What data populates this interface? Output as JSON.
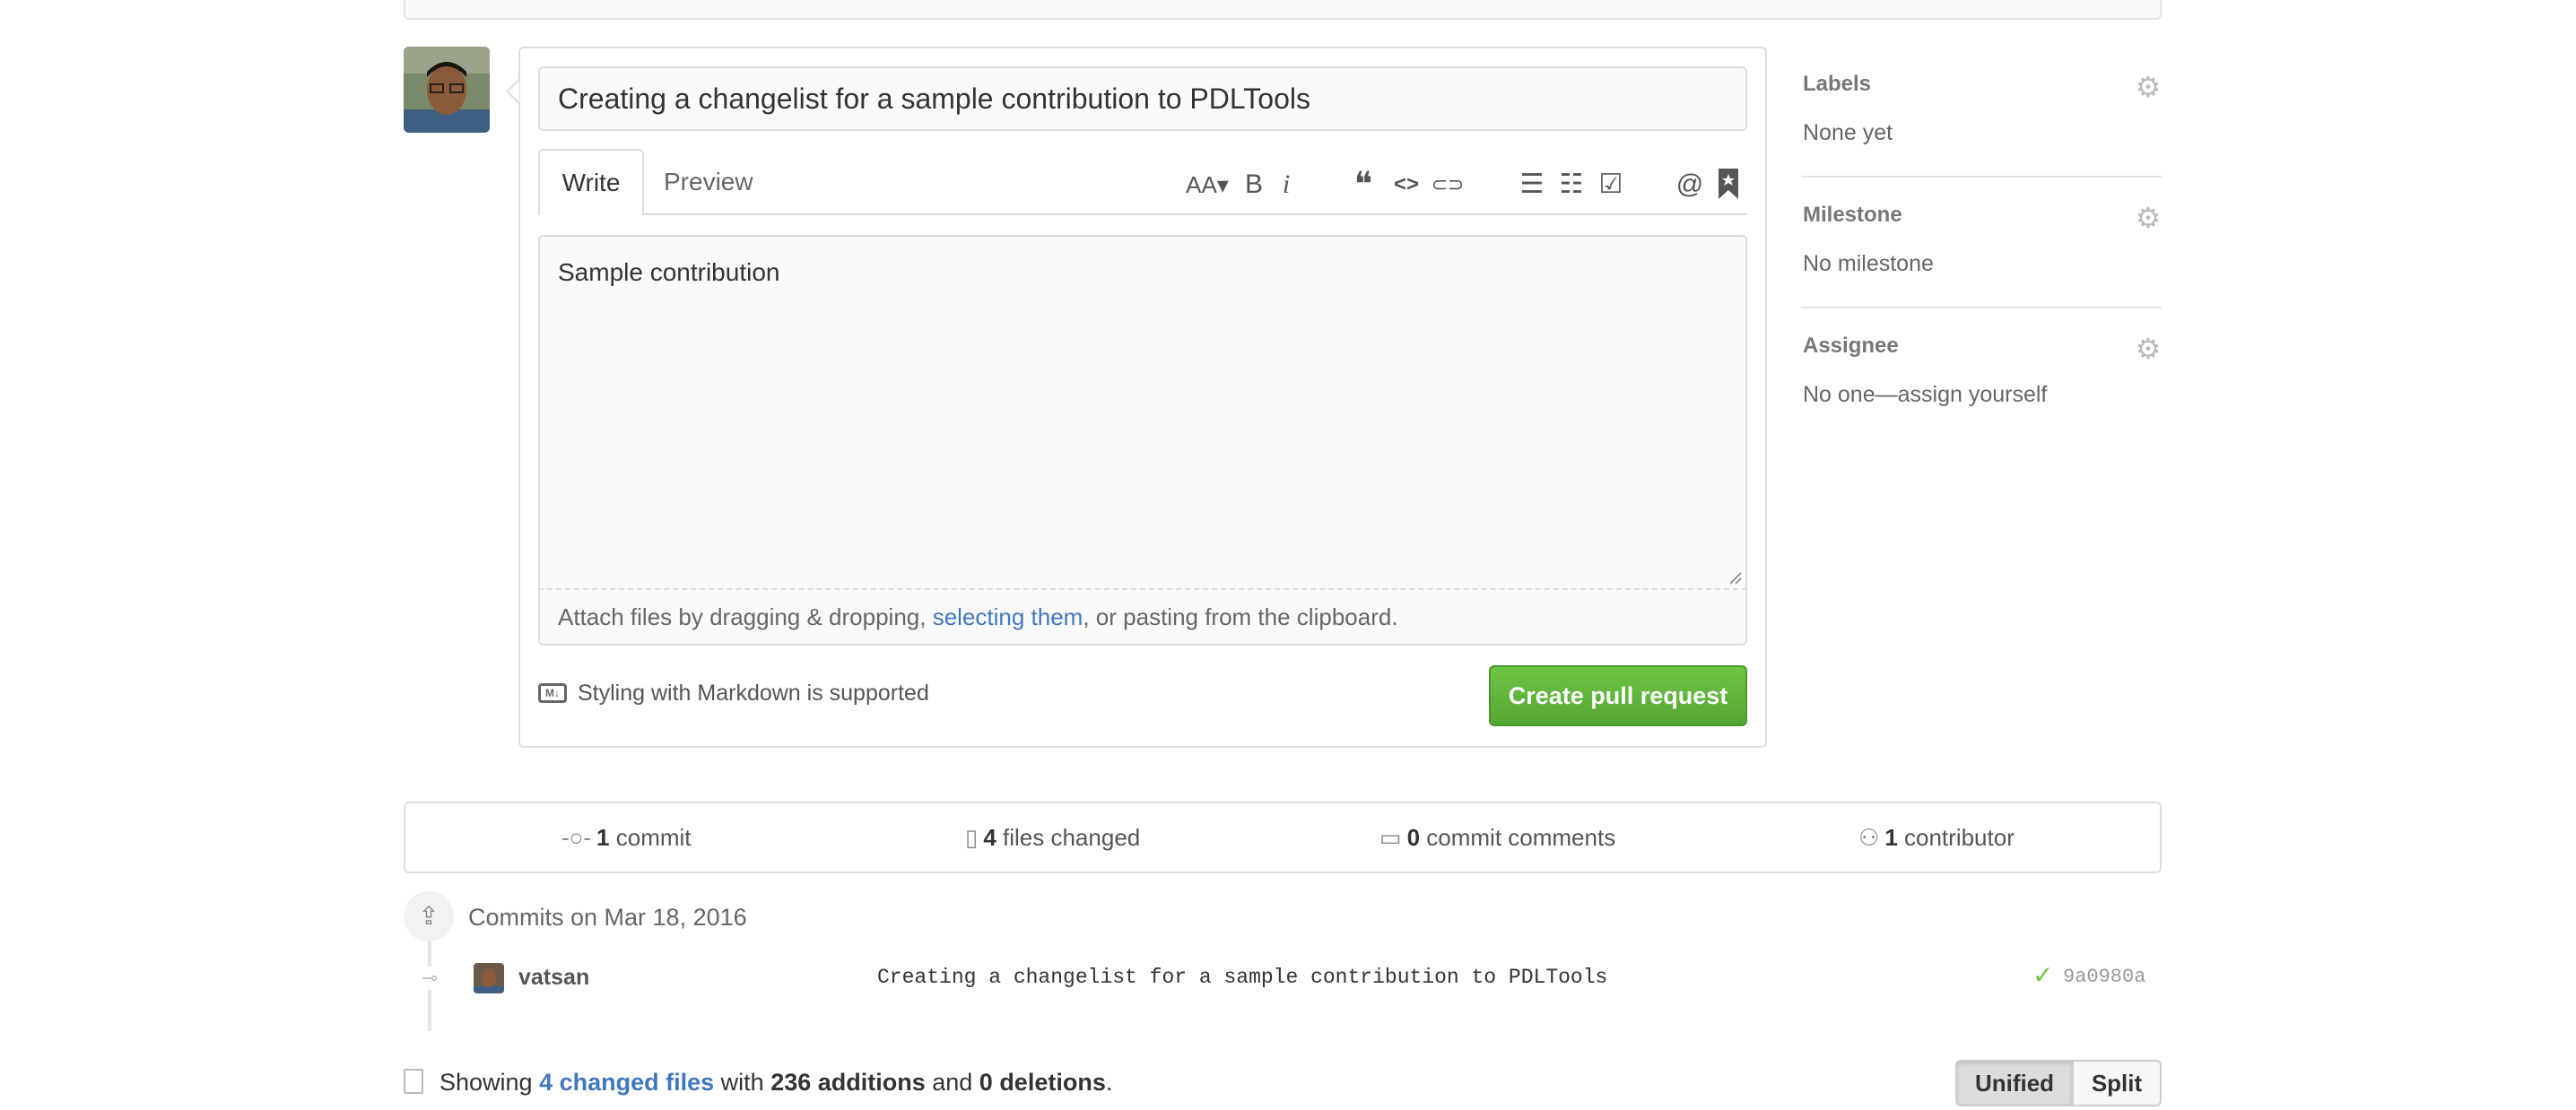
{
  "pull_request_form": {
    "title_value": "Creating a changelist for a sample contribution to PDLTools",
    "tabs": [
      "Write",
      "Preview"
    ],
    "body_value": "Sample contribution",
    "attach_prefix": "Attach files by dragging & dropping, ",
    "attach_link": "selecting them",
    "attach_suffix": ", or pasting from the clipboard.",
    "markdown_note": "Styling with Markdown is supported",
    "markdown_badge": "M↓",
    "submit_label": "Create pull request",
    "toolbar": {
      "header": "AA▾",
      "bold": "B",
      "italic": "i",
      "quote": "❝",
      "code": "<>",
      "link": "⊂⊃",
      "bullet_list": "☰",
      "numbered_list": "☷",
      "task_list": "☑",
      "mention": "@",
      "reference": "🔖"
    }
  },
  "sidebar": {
    "labels": {
      "heading": "Labels",
      "value": "None yet"
    },
    "milestone": {
      "heading": "Milestone",
      "value": "No milestone"
    },
    "assignee": {
      "heading": "Assignee",
      "value": "No one—assign yourself"
    },
    "gear_glyph": "⚙"
  },
  "stats": {
    "commits": {
      "count": "1",
      "label": "commit"
    },
    "files": {
      "count": "4",
      "label": "files changed"
    },
    "comments": {
      "count": "0",
      "label": "commit comments"
    },
    "contributors": {
      "count": "1",
      "label": "contributor"
    }
  },
  "commits": {
    "date_heading": "Commits on Mar 18, 2016",
    "items": [
      {
        "author": "vatsan",
        "message": "Creating a changelist for a sample contribution to PDLTools",
        "sha": "9a0980a",
        "status": "✓"
      }
    ]
  },
  "diff_summary": {
    "prefix": "Showing ",
    "files_link": "4 changed files",
    "with": " with ",
    "additions": "236 additions",
    "and": " and ",
    "deletions": "0 deletions",
    "suffix": "."
  },
  "view_toggle": {
    "unified": "Unified",
    "split": "Split",
    "selected": "Unified"
  },
  "colors": {
    "accent_link": "#4078c0",
    "create_button": "#6cc644",
    "check": "#6cc644"
  }
}
